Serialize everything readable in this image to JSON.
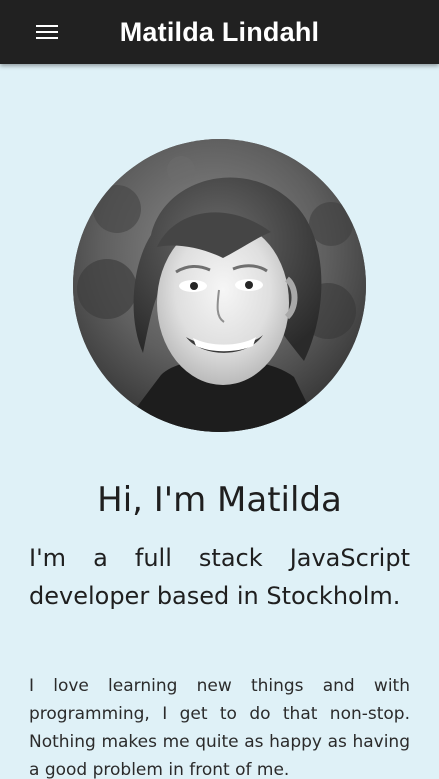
{
  "appbar": {
    "title": "Matilda Lindahl",
    "menu_icon": "menu-icon"
  },
  "profile": {
    "photo_icon": "portrait-photo",
    "headline": "Hi, I'm Matilda",
    "subheadline": "I'm a full stack JavaScript developer based in Stockholm.",
    "bio": "I love learning new things and with programming, I get to do that non-stop. Nothing makes me quite as happy as having a good problem in front of me."
  },
  "colors": {
    "appbar_background": "#212121",
    "page_background": "#dff1f7",
    "text": "#1f1f1f"
  }
}
